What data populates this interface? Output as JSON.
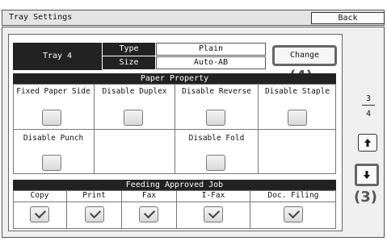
{
  "window": {
    "title": "Tray Settings",
    "back_label": "Back"
  },
  "tray": {
    "name": "Tray 4",
    "type_label": "Type",
    "size_label": "Size",
    "type_value": "Plain",
    "size_value": "Auto-AB",
    "change_label": "Change"
  },
  "callouts": {
    "change": "(4)",
    "down": "(3)"
  },
  "paper_property": {
    "header": "Paper Property",
    "items": [
      {
        "label": "Fixed Paper Side",
        "checked": false
      },
      {
        "label": "Disable Duplex",
        "checked": false
      },
      {
        "label": "Disable Reverse",
        "checked": false
      },
      {
        "label": "Disable Staple",
        "checked": false
      },
      {
        "label": "Disable Punch",
        "checked": false
      },
      {
        "label": "Disable Fold",
        "checked": false
      }
    ]
  },
  "feeding": {
    "header": "Feeding Approved Job",
    "items": [
      {
        "label": "Copy",
        "checked": true
      },
      {
        "label": "Print",
        "checked": true
      },
      {
        "label": "Fax",
        "checked": true
      },
      {
        "label": "I-Fax",
        "checked": true
      },
      {
        "label": "Doc. Filing",
        "checked": true
      }
    ]
  },
  "pager": {
    "current": "3",
    "total": "4"
  },
  "icons": {
    "up": "arrow-up-icon",
    "down": "arrow-down-icon"
  }
}
